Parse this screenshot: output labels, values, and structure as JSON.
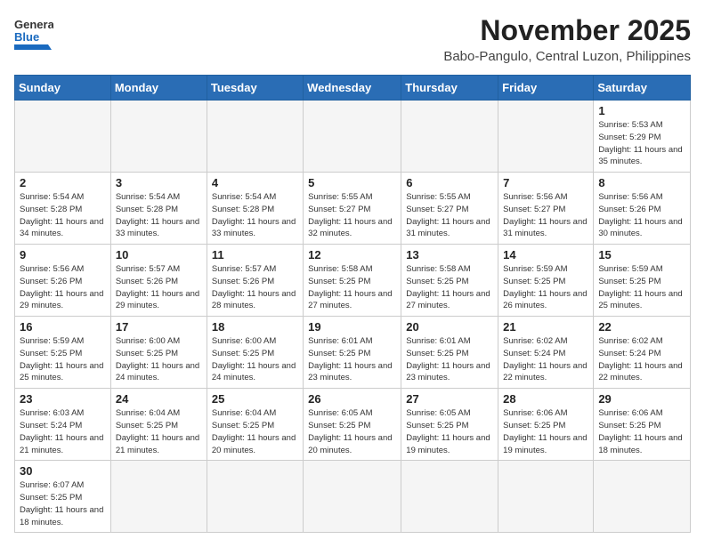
{
  "header": {
    "logo_line1": "General",
    "logo_line2": "Blue",
    "month": "November 2025",
    "location": "Babo-Pangulo, Central Luzon, Philippines"
  },
  "days_of_week": [
    "Sunday",
    "Monday",
    "Tuesday",
    "Wednesday",
    "Thursday",
    "Friday",
    "Saturday"
  ],
  "weeks": [
    [
      {
        "day": null,
        "sunrise": "",
        "sunset": "",
        "daylight": ""
      },
      {
        "day": null,
        "sunrise": "",
        "sunset": "",
        "daylight": ""
      },
      {
        "day": null,
        "sunrise": "",
        "sunset": "",
        "daylight": ""
      },
      {
        "day": null,
        "sunrise": "",
        "sunset": "",
        "daylight": ""
      },
      {
        "day": null,
        "sunrise": "",
        "sunset": "",
        "daylight": ""
      },
      {
        "day": null,
        "sunrise": "",
        "sunset": "",
        "daylight": ""
      },
      {
        "day": 1,
        "sunrise": "5:53 AM",
        "sunset": "5:29 PM",
        "daylight": "11 hours and 35 minutes."
      }
    ],
    [
      {
        "day": 2,
        "sunrise": "5:54 AM",
        "sunset": "5:28 PM",
        "daylight": "11 hours and 34 minutes."
      },
      {
        "day": 3,
        "sunrise": "5:54 AM",
        "sunset": "5:28 PM",
        "daylight": "11 hours and 33 minutes."
      },
      {
        "day": 4,
        "sunrise": "5:54 AM",
        "sunset": "5:28 PM",
        "daylight": "11 hours and 33 minutes."
      },
      {
        "day": 5,
        "sunrise": "5:55 AM",
        "sunset": "5:27 PM",
        "daylight": "11 hours and 32 minutes."
      },
      {
        "day": 6,
        "sunrise": "5:55 AM",
        "sunset": "5:27 PM",
        "daylight": "11 hours and 31 minutes."
      },
      {
        "day": 7,
        "sunrise": "5:56 AM",
        "sunset": "5:27 PM",
        "daylight": "11 hours and 31 minutes."
      },
      {
        "day": 8,
        "sunrise": "5:56 AM",
        "sunset": "5:26 PM",
        "daylight": "11 hours and 30 minutes."
      }
    ],
    [
      {
        "day": 9,
        "sunrise": "5:56 AM",
        "sunset": "5:26 PM",
        "daylight": "11 hours and 29 minutes."
      },
      {
        "day": 10,
        "sunrise": "5:57 AM",
        "sunset": "5:26 PM",
        "daylight": "11 hours and 29 minutes."
      },
      {
        "day": 11,
        "sunrise": "5:57 AM",
        "sunset": "5:26 PM",
        "daylight": "11 hours and 28 minutes."
      },
      {
        "day": 12,
        "sunrise": "5:58 AM",
        "sunset": "5:25 PM",
        "daylight": "11 hours and 27 minutes."
      },
      {
        "day": 13,
        "sunrise": "5:58 AM",
        "sunset": "5:25 PM",
        "daylight": "11 hours and 27 minutes."
      },
      {
        "day": 14,
        "sunrise": "5:59 AM",
        "sunset": "5:25 PM",
        "daylight": "11 hours and 26 minutes."
      },
      {
        "day": 15,
        "sunrise": "5:59 AM",
        "sunset": "5:25 PM",
        "daylight": "11 hours and 25 minutes."
      }
    ],
    [
      {
        "day": 16,
        "sunrise": "5:59 AM",
        "sunset": "5:25 PM",
        "daylight": "11 hours and 25 minutes."
      },
      {
        "day": 17,
        "sunrise": "6:00 AM",
        "sunset": "5:25 PM",
        "daylight": "11 hours and 24 minutes."
      },
      {
        "day": 18,
        "sunrise": "6:00 AM",
        "sunset": "5:25 PM",
        "daylight": "11 hours and 24 minutes."
      },
      {
        "day": 19,
        "sunrise": "6:01 AM",
        "sunset": "5:25 PM",
        "daylight": "11 hours and 23 minutes."
      },
      {
        "day": 20,
        "sunrise": "6:01 AM",
        "sunset": "5:25 PM",
        "daylight": "11 hours and 23 minutes."
      },
      {
        "day": 21,
        "sunrise": "6:02 AM",
        "sunset": "5:24 PM",
        "daylight": "11 hours and 22 minutes."
      },
      {
        "day": 22,
        "sunrise": "6:02 AM",
        "sunset": "5:24 PM",
        "daylight": "11 hours and 22 minutes."
      }
    ],
    [
      {
        "day": 23,
        "sunrise": "6:03 AM",
        "sunset": "5:24 PM",
        "daylight": "11 hours and 21 minutes."
      },
      {
        "day": 24,
        "sunrise": "6:04 AM",
        "sunset": "5:25 PM",
        "daylight": "11 hours and 21 minutes."
      },
      {
        "day": 25,
        "sunrise": "6:04 AM",
        "sunset": "5:25 PM",
        "daylight": "11 hours and 20 minutes."
      },
      {
        "day": 26,
        "sunrise": "6:05 AM",
        "sunset": "5:25 PM",
        "daylight": "11 hours and 20 minutes."
      },
      {
        "day": 27,
        "sunrise": "6:05 AM",
        "sunset": "5:25 PM",
        "daylight": "11 hours and 19 minutes."
      },
      {
        "day": 28,
        "sunrise": "6:06 AM",
        "sunset": "5:25 PM",
        "daylight": "11 hours and 19 minutes."
      },
      {
        "day": 29,
        "sunrise": "6:06 AM",
        "sunset": "5:25 PM",
        "daylight": "11 hours and 18 minutes."
      }
    ],
    [
      {
        "day": 30,
        "sunrise": "6:07 AM",
        "sunset": "5:25 PM",
        "daylight": "11 hours and 18 minutes."
      },
      {
        "day": null
      },
      {
        "day": null
      },
      {
        "day": null
      },
      {
        "day": null
      },
      {
        "day": null
      },
      {
        "day": null
      }
    ]
  ]
}
